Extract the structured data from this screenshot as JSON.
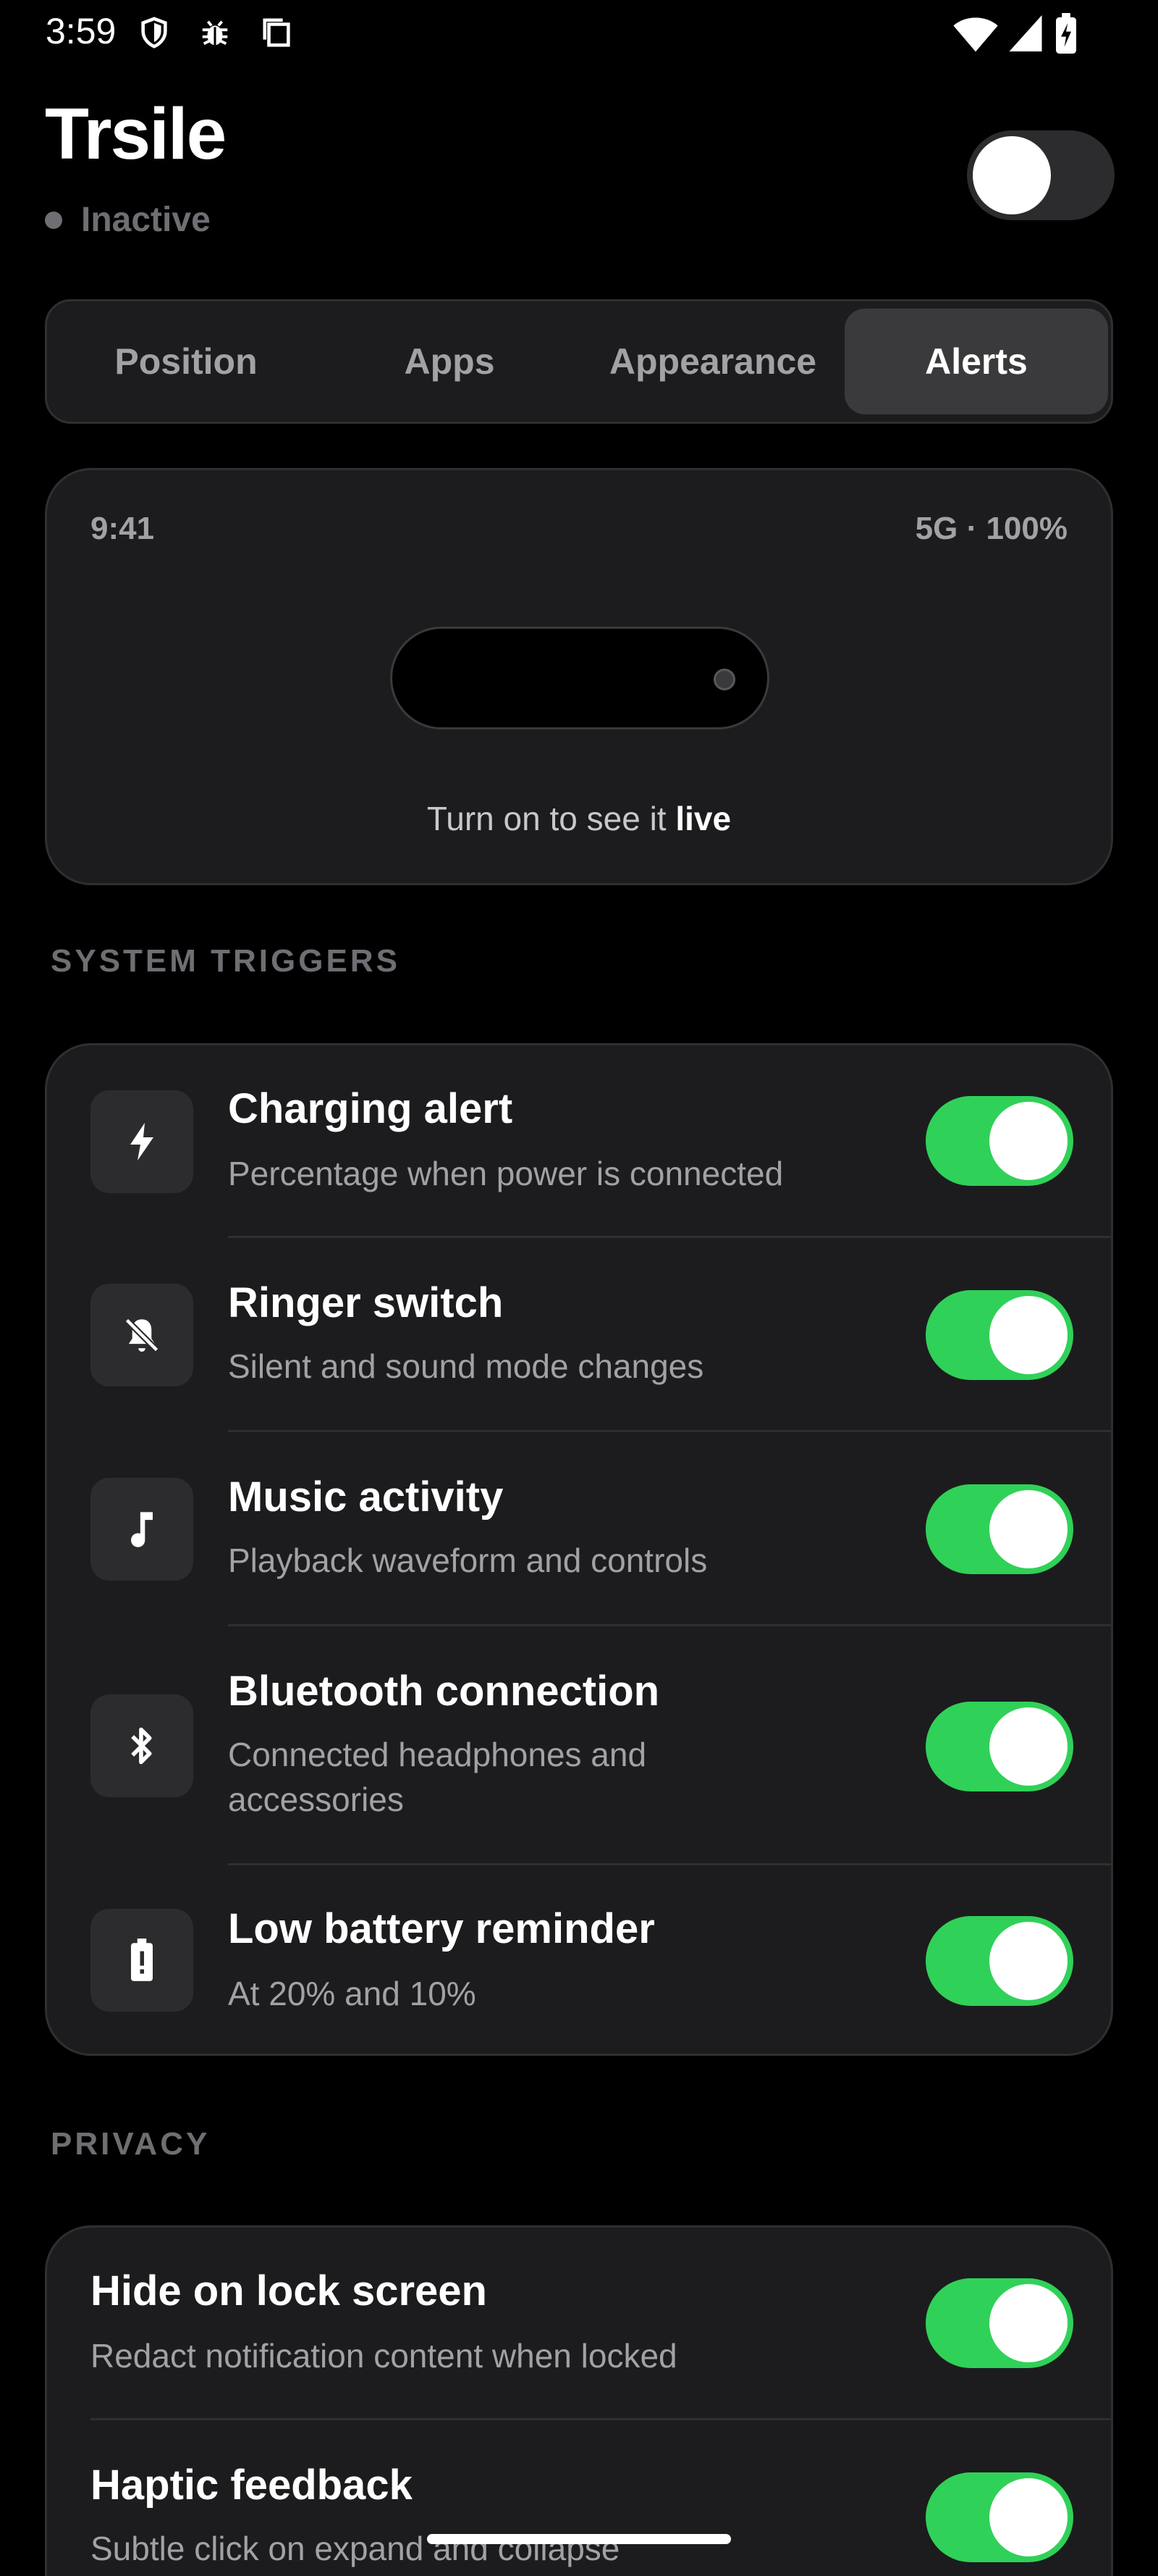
{
  "status_bar": {
    "time": "3:59",
    "icons": [
      "shield-icon",
      "bug-icon",
      "screenshot-icon",
      "wifi-icon",
      "signal-icon",
      "battery-charging-icon"
    ]
  },
  "header": {
    "title": "Trsile",
    "status": "Inactive",
    "master_toggle_on": false
  },
  "tabs": [
    {
      "label": "Position",
      "active": false
    },
    {
      "label": "Apps",
      "active": false
    },
    {
      "label": "Appearance",
      "active": false
    },
    {
      "label": "Alerts",
      "active": true
    }
  ],
  "preview": {
    "time": "9:41",
    "meta": "5G · 100%",
    "hint_prefix": "Turn on to see it",
    "hint_emphasis": "live"
  },
  "system_triggers": {
    "header": "SYSTEM TRIGGERS",
    "items": [
      {
        "title": "Charging alert",
        "subtitle": "Percentage when power is connected",
        "icon": "bolt-icon",
        "enabled": true
      },
      {
        "title": "Ringer switch",
        "subtitle": "Silent and sound mode changes",
        "icon": "bell-off-icon",
        "enabled": true
      },
      {
        "title": "Music activity",
        "subtitle": "Playback waveform and controls",
        "icon": "music-note-icon",
        "enabled": true
      },
      {
        "title": "Bluetooth connection",
        "subtitle": "Connected headphones and accessories",
        "icon": "bluetooth-icon",
        "enabled": true
      },
      {
        "title": "Low battery reminder",
        "subtitle": "At 20% and 10%",
        "icon": "battery-alert-icon",
        "enabled": true
      }
    ]
  },
  "privacy": {
    "header": "PRIVACY",
    "items": [
      {
        "title": "Hide on lock screen",
        "subtitle": "Redact notification content when locked",
        "enabled": true
      },
      {
        "title": "Haptic feedback",
        "subtitle": "Subtle click on expand and collapse",
        "enabled": true
      }
    ]
  },
  "colors": {
    "accent_green": "#30d158",
    "card_bg": "#1c1c1e",
    "muted_text": "#a1a1a6"
  }
}
